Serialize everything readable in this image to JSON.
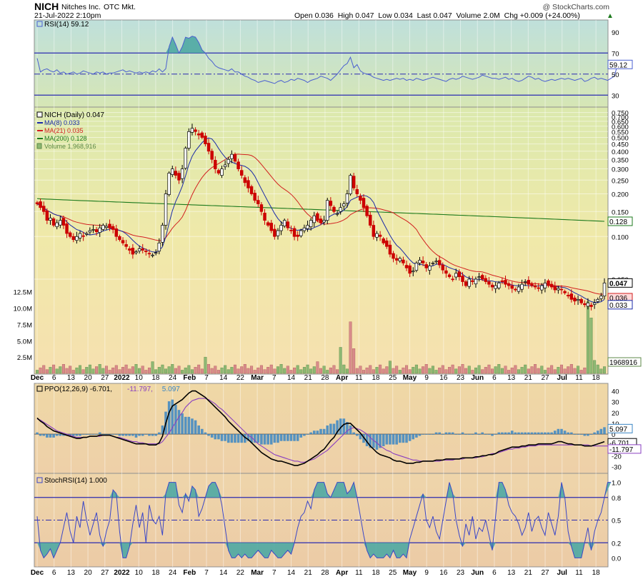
{
  "header": {
    "symbol": "NICH",
    "company": "Nitches Inc.",
    "exchange": "OTC Mkt.",
    "watermark": "@ StockCharts.com",
    "datetime": "21-Jul-2022 2:10pm",
    "quote": "Open 0.036  High 0.047  Low 0.034  Last 0.047  Volume 2.0M  Chg +0.009 (+24.00%)",
    "quote_arrow": "▲"
  },
  "colors": {
    "up": "#ffffff",
    "down": "#cc0000",
    "candle_outline": "#000000",
    "ma8": "#1a2aa8",
    "ma21": "#d22020",
    "ma200": "#1d7a1d",
    "rsi_line": "#4a5fd0",
    "rsi_fill": "#4ea9a3",
    "ppo_line": "#000000",
    "ppo_signal": "#8a3fc0",
    "ppo_hist": "#3a86c4",
    "stoch_line": "#3a46c8",
    "stoch_fill": "#4ea9a3",
    "vol_up": "#8db873",
    "vol_down": "#d88b8b",
    "ref_line": "#2b2bb0"
  },
  "chart_data": [
    {
      "type": "line",
      "panel": "rsi",
      "label": "RSI(14) 59.12",
      "current": "59.12",
      "yticks": [
        "90",
        "70",
        "50",
        "30"
      ],
      "ylim": [
        20,
        100
      ],
      "ref_levels": [
        70,
        30
      ],
      "mid_level": 50,
      "values": [
        65,
        52,
        54,
        55,
        53,
        52,
        54,
        51,
        52,
        50,
        51,
        52,
        50,
        51,
        53,
        52,
        51,
        50,
        52,
        51,
        52,
        50,
        51,
        51,
        52,
        53,
        54,
        52,
        53,
        52,
        51,
        52,
        51,
        52,
        51,
        53,
        52,
        55,
        52,
        55,
        76,
        85,
        78,
        70,
        76,
        85,
        84,
        86,
        85,
        80,
        73,
        70,
        65,
        62,
        58,
        56,
        55,
        54,
        53,
        55,
        52,
        52,
        50,
        48,
        47,
        45,
        44,
        42,
        43,
        44,
        43,
        42,
        41,
        43,
        44,
        42,
        43,
        45,
        44,
        46,
        45,
        44,
        42,
        44,
        45,
        46,
        48,
        47,
        46,
        44,
        47,
        50,
        54,
        58,
        60,
        66,
        56,
        59,
        53,
        51,
        50,
        49,
        47,
        46,
        45,
        44,
        45,
        44,
        45,
        46,
        45,
        46,
        44,
        45,
        44,
        46,
        45,
        44,
        45,
        46,
        47,
        46,
        45,
        44,
        43,
        45,
        46,
        45,
        46,
        48,
        47,
        46,
        45,
        46,
        47,
        49,
        48,
        47,
        46,
        46,
        45,
        46,
        47,
        45,
        46,
        44,
        43,
        44,
        46,
        48,
        47,
        45,
        46,
        44,
        43,
        44,
        45,
        44,
        45,
        46,
        45,
        46,
        45,
        44,
        45,
        46,
        43,
        44,
        46,
        47,
        45,
        46,
        45,
        44,
        46,
        48,
        59
      ]
    },
    {
      "type": "candlestick",
      "panel": "price",
      "label": "NICH (Daily) 0.047",
      "scale": "log",
      "ylim": [
        0.02,
        0.8
      ],
      "yticks": [
        0.75,
        0.7,
        0.65,
        0.6,
        0.55,
        0.5,
        0.45,
        0.4,
        0.35,
        0.3,
        0.25,
        0.2,
        0.15,
        0.1,
        0.05
      ],
      "ytick_labels": [
        "0.750",
        "0.700",
        "0.650",
        "0.600",
        "0.550",
        "0.500",
        "0.450",
        "0.400",
        "0.350",
        "0.300",
        "0.250",
        "0.200",
        "0.150",
        "0.100",
        "0.050"
      ],
      "last_price": "0.047",
      "badges": [
        {
          "name": "MA(200)",
          "text": "0.128",
          "value": 0.128
        },
        {
          "name": "MA(8)",
          "text": "0.033",
          "value": 0.033
        }
      ],
      "partial_badge": "0.036",
      "legend": [
        {
          "text": "NICH (Daily) 0.047",
          "key": "up"
        },
        {
          "text": "MA(8) 0.033",
          "key": "ma8"
        },
        {
          "text": "MA(21) 0.035",
          "key": "ma21"
        },
        {
          "text": "MA(200) 0.128",
          "key": "ma200"
        },
        {
          "text": "Volume 1,968,916",
          "key": "vol_up"
        }
      ],
      "close": [
        0.17,
        0.16,
        0.15,
        0.13,
        0.135,
        0.12,
        0.125,
        0.13,
        0.12,
        0.105,
        0.1,
        0.095,
        0.1,
        0.105,
        0.1,
        0.105,
        0.11,
        0.112,
        0.108,
        0.115,
        0.12,
        0.118,
        0.115,
        0.112,
        0.1,
        0.095,
        0.09,
        0.085,
        0.08,
        0.075,
        0.078,
        0.082,
        0.08,
        0.078,
        0.076,
        0.074,
        0.077,
        0.09,
        0.12,
        0.2,
        0.28,
        0.3,
        0.27,
        0.25,
        0.3,
        0.42,
        0.55,
        0.58,
        0.55,
        0.52,
        0.5,
        0.45,
        0.4,
        0.35,
        0.3,
        0.28,
        0.3,
        0.32,
        0.35,
        0.38,
        0.34,
        0.3,
        0.27,
        0.24,
        0.22,
        0.2,
        0.18,
        0.17,
        0.15,
        0.13,
        0.12,
        0.11,
        0.1,
        0.11,
        0.12,
        0.13,
        0.115,
        0.11,
        0.1,
        0.1,
        0.11,
        0.115,
        0.12,
        0.13,
        0.14,
        0.13,
        0.125,
        0.13,
        0.18,
        0.165,
        0.15,
        0.145,
        0.16,
        0.17,
        0.2,
        0.27,
        0.22,
        0.2,
        0.18,
        0.16,
        0.14,
        0.12,
        0.1,
        0.105,
        0.1,
        0.09,
        0.085,
        0.075,
        0.07,
        0.068,
        0.07,
        0.065,
        0.06,
        0.055,
        0.057,
        0.065,
        0.068,
        0.065,
        0.06,
        0.062,
        0.065,
        0.067,
        0.063,
        0.058,
        0.055,
        0.052,
        0.05,
        0.055,
        0.052,
        0.048,
        0.045,
        0.05,
        0.048,
        0.05,
        0.052,
        0.05,
        0.048,
        0.046,
        0.044,
        0.045,
        0.047,
        0.048,
        0.046,
        0.045,
        0.043,
        0.042,
        0.044,
        0.046,
        0.048,
        0.046,
        0.045,
        0.044,
        0.043,
        0.045,
        0.047,
        0.045,
        0.044,
        0.042,
        0.043,
        0.042,
        0.04,
        0.038,
        0.036,
        0.035,
        0.036,
        0.034,
        0.033,
        0.034,
        0.032,
        0.034,
        0.036,
        0.038,
        0.047
      ],
      "ma200_start": 0.185,
      "ma200_end": 0.128,
      "volume_ylim": [
        0,
        14000000
      ],
      "volume_ticks": [
        12500000,
        10000000,
        7500000,
        5000000,
        2500000
      ],
      "volume_tick_labels": [
        "12.5M",
        "10.0M",
        "7.5M",
        "5.0M",
        "2.5M"
      ],
      "volume_badge": "1968916",
      "volume_spikes": [
        {
          "index": 35,
          "value": 1800000,
          "up": true
        },
        {
          "index": 51,
          "value": 2500000,
          "up": true
        },
        {
          "index": 85,
          "value": 1800000,
          "up": false
        },
        {
          "index": 92,
          "value": 4000000,
          "up": true
        },
        {
          "index": 95,
          "value": 7900000,
          "up": false
        },
        {
          "index": 96,
          "value": 3800000,
          "up": false
        },
        {
          "index": 107,
          "value": 1900000,
          "up": true
        },
        {
          "index": 167,
          "value": 11000000,
          "up": true
        },
        {
          "index": 168,
          "value": 8500000,
          "up": true
        },
        {
          "index": 169,
          "value": 2000000,
          "up": true
        }
      ]
    },
    {
      "type": "line",
      "panel": "ppo",
      "label": "PPO(12,26,9) -6.701, -11.797, 5.097",
      "legend": [
        {
          "text": "PPO(12,26,9) -6.701,",
          "key": "ppo_line"
        },
        {
          "text": "-11.797,",
          "key": "ppo_signal"
        },
        {
          "text": "5.097",
          "key": "ppo_hist"
        }
      ],
      "ylim": [
        -35,
        45
      ],
      "yticks": [
        40,
        30,
        20,
        10,
        0,
        -10,
        -20,
        -30
      ],
      "badges": [
        "5.097",
        "-6.701",
        "-11.797"
      ],
      "ppo": [
        15,
        12,
        10,
        7,
        5,
        3,
        2,
        1,
        0,
        -1,
        -2,
        -3,
        -4,
        -4,
        -3,
        -3,
        -2,
        -2,
        -2,
        -1,
        -1,
        -1,
        -1,
        -2,
        -3,
        -4,
        -5,
        -6,
        -7,
        -8,
        -9,
        -9,
        -9,
        -9,
        -10,
        -10,
        -10,
        -8,
        -2,
        10,
        20,
        26,
        28,
        30,
        32,
        35,
        38,
        40,
        40,
        38,
        36,
        34,
        31,
        28,
        25,
        22,
        19,
        16,
        12,
        9,
        6,
        3,
        0,
        -3,
        -5,
        -8,
        -11,
        -14,
        -17,
        -19,
        -21,
        -23,
        -24,
        -25,
        -25,
        -26,
        -27,
        -28,
        -29,
        -29,
        -28,
        -27,
        -25,
        -23,
        -21,
        -19,
        -16,
        -14,
        -10,
        -6,
        -3,
        2,
        6,
        9,
        10,
        10,
        7,
        4,
        1,
        -3,
        -7,
        -11,
        -14,
        -17,
        -19,
        -20,
        -21,
        -22,
        -24,
        -25,
        -25,
        -26,
        -27,
        -27,
        -27,
        -26,
        -26,
        -25,
        -25,
        -25,
        -25,
        -24,
        -24,
        -24,
        -23,
        -23,
        -23,
        -23,
        -23,
        -22,
        -22,
        -22,
        -22,
        -21,
        -21,
        -20,
        -20,
        -19,
        -19,
        -18,
        -16,
        -15,
        -14,
        -13,
        -12,
        -12,
        -12,
        -11,
        -11,
        -10,
        -10,
        -10,
        -9,
        -9,
        -9,
        -9,
        -9,
        -8,
        -7,
        -7,
        -8,
        -9,
        -9,
        -10,
        -10,
        -10,
        -11,
        -11,
        -11,
        -10,
        -9,
        -8,
        -7
      ],
      "signal": [
        14,
        13,
        11,
        9,
        7,
        5,
        3,
        2,
        1,
        0,
        -1,
        -2,
        -3,
        -3,
        -3,
        -3,
        -2,
        -2,
        -2,
        -2,
        -1,
        -1,
        -1,
        -2,
        -3,
        -3,
        -4,
        -5,
        -6,
        -7,
        -7,
        -8,
        -8,
        -9,
        -9,
        -9,
        -9,
        -9,
        -7,
        -3,
        1,
        6,
        11,
        16,
        20,
        25,
        28,
        31,
        32,
        33,
        33,
        33,
        32,
        30,
        28,
        25,
        23,
        20,
        17,
        14,
        11,
        8,
        5,
        2,
        -1,
        -3,
        -6,
        -9,
        -11,
        -13,
        -15,
        -17,
        -19,
        -20,
        -21,
        -22,
        -23,
        -24,
        -25,
        -25,
        -26,
        -26,
        -25,
        -24,
        -23,
        -21,
        -19,
        -17,
        -15,
        -12,
        -9,
        -6,
        -3,
        0,
        3,
        5,
        6,
        5,
        4,
        2,
        0,
        -3,
        -6,
        -8,
        -11,
        -13,
        -15,
        -16,
        -18,
        -19,
        -20,
        -21,
        -22,
        -23,
        -24,
        -24,
        -25,
        -25,
        -25,
        -25,
        -25,
        -25,
        -25,
        -24,
        -24,
        -24,
        -24,
        -23,
        -23,
        -23,
        -22,
        -22,
        -22,
        -22,
        -21,
        -21,
        -20,
        -19,
        -18,
        -18,
        -17,
        -16,
        -15,
        -14,
        -14,
        -13,
        -13,
        -12,
        -12,
        -11,
        -11,
        -11,
        -10,
        -10,
        -10,
        -10,
        -10,
        -10,
        -10,
        -10,
        -10,
        -10,
        -10,
        -10,
        -10,
        -10,
        -10,
        -10,
        -11,
        -11,
        -11,
        -11,
        -11,
        -11,
        -11
      ]
    },
    {
      "type": "line",
      "panel": "stochrsi",
      "label": "StochRSI(14) 1.000",
      "ylim": [
        -0.1,
        1.1
      ],
      "yticks": [
        1.0,
        0.8,
        0.5,
        0.2,
        0.0
      ],
      "ytick_labels": [
        "1.0",
        "0.8",
        "0.5",
        "0.2",
        "0.0"
      ],
      "ref_levels": [
        0.8,
        0.2
      ],
      "mid_level": 0.5,
      "values": [
        0.55,
        0.1,
        0.0,
        0.05,
        0.12,
        0.0,
        0.1,
        0.2,
        0.4,
        0.6,
        0.35,
        0.2,
        0.55,
        0.4,
        0.75,
        0.5,
        0.3,
        0.45,
        0.6,
        0.3,
        0.15,
        0.35,
        0.5,
        0.9,
        0.85,
        0.35,
        0.0,
        0.0,
        0.15,
        0.45,
        0.7,
        0.4,
        0.6,
        0.2,
        0.7,
        0.5,
        0.45,
        0.55,
        0.3,
        0.85,
        1.0,
        1.0,
        1.0,
        0.7,
        0.6,
        0.85,
        0.75,
        0.95,
        0.9,
        0.55,
        0.65,
        0.8,
        0.95,
        1.0,
        1.0,
        0.9,
        0.7,
        0.4,
        0.1,
        0.0,
        0.0,
        0.05,
        0.0,
        0.05,
        0.0,
        0.0,
        0.05,
        0.1,
        0.05,
        0.0,
        0.0,
        0.1,
        0.05,
        0.0,
        0.0,
        0.05,
        0.1,
        0.05,
        0.2,
        0.4,
        0.55,
        0.6,
        0.75,
        0.65,
        0.9,
        1.0,
        1.0,
        1.0,
        0.85,
        0.8,
        0.9,
        1.0,
        1.0,
        1.0,
        0.85,
        0.9,
        1.0,
        0.8,
        0.55,
        0.3,
        0.1,
        0.0,
        0.05,
        0.0,
        0.0,
        0.0,
        0.05,
        0.0,
        0.1,
        0.0,
        0.0,
        0.05,
        0.0,
        0.25,
        0.4,
        0.55,
        0.7,
        0.85,
        0.5,
        0.4,
        0.55,
        0.35,
        0.25,
        0.5,
        0.75,
        1.0,
        0.85,
        0.5,
        0.3,
        0.15,
        0.45,
        0.3,
        0.55,
        0.25,
        0.4,
        0.35,
        0.5,
        0.3,
        0.1,
        0.55,
        1.0,
        1.0,
        0.9,
        0.7,
        0.6,
        0.55,
        0.45,
        0.3,
        0.4,
        0.6,
        0.35,
        0.5,
        0.55,
        0.4,
        0.3,
        0.6,
        0.45,
        0.3,
        0.55,
        1.0,
        0.8,
        0.35,
        0.15,
        0.0,
        0.0,
        0.0,
        0.2,
        0.4,
        0.1,
        0.35,
        0.5,
        0.6,
        0.8,
        1.0,
        1.0
      ]
    }
  ],
  "x_axis": {
    "labels": [
      {
        "text": "Dec",
        "bold": true
      },
      {
        "text": "6",
        "bold": false
      },
      {
        "text": "13",
        "bold": false
      },
      {
        "text": "20",
        "bold": false
      },
      {
        "text": "27",
        "bold": false
      },
      {
        "text": "2022",
        "bold": true
      },
      {
        "text": "10",
        "bold": false
      },
      {
        "text": "18",
        "bold": false
      },
      {
        "text": "24",
        "bold": false
      },
      {
        "text": "Feb",
        "bold": true
      },
      {
        "text": "7",
        "bold": false
      },
      {
        "text": "14",
        "bold": false
      },
      {
        "text": "22",
        "bold": false
      },
      {
        "text": "Mar",
        "bold": true
      },
      {
        "text": "7",
        "bold": false
      },
      {
        "text": "14",
        "bold": false
      },
      {
        "text": "21",
        "bold": false
      },
      {
        "text": "28",
        "bold": false
      },
      {
        "text": "Apr",
        "bold": true
      },
      {
        "text": "11",
        "bold": false
      },
      {
        "text": "18",
        "bold": false
      },
      {
        "text": "25",
        "bold": false
      },
      {
        "text": "May",
        "bold": true
      },
      {
        "text": "9",
        "bold": false
      },
      {
        "text": "16",
        "bold": false
      },
      {
        "text": "23",
        "bold": false
      },
      {
        "text": "Jun",
        "bold": true
      },
      {
        "text": "6",
        "bold": false
      },
      {
        "text": "13",
        "bold": false
      },
      {
        "text": "21",
        "bold": false
      },
      {
        "text": "27",
        "bold": false
      },
      {
        "text": "Jul",
        "bold": true
      },
      {
        "text": "11",
        "bold": false
      },
      {
        "text": "18",
        "bold": false
      }
    ]
  }
}
